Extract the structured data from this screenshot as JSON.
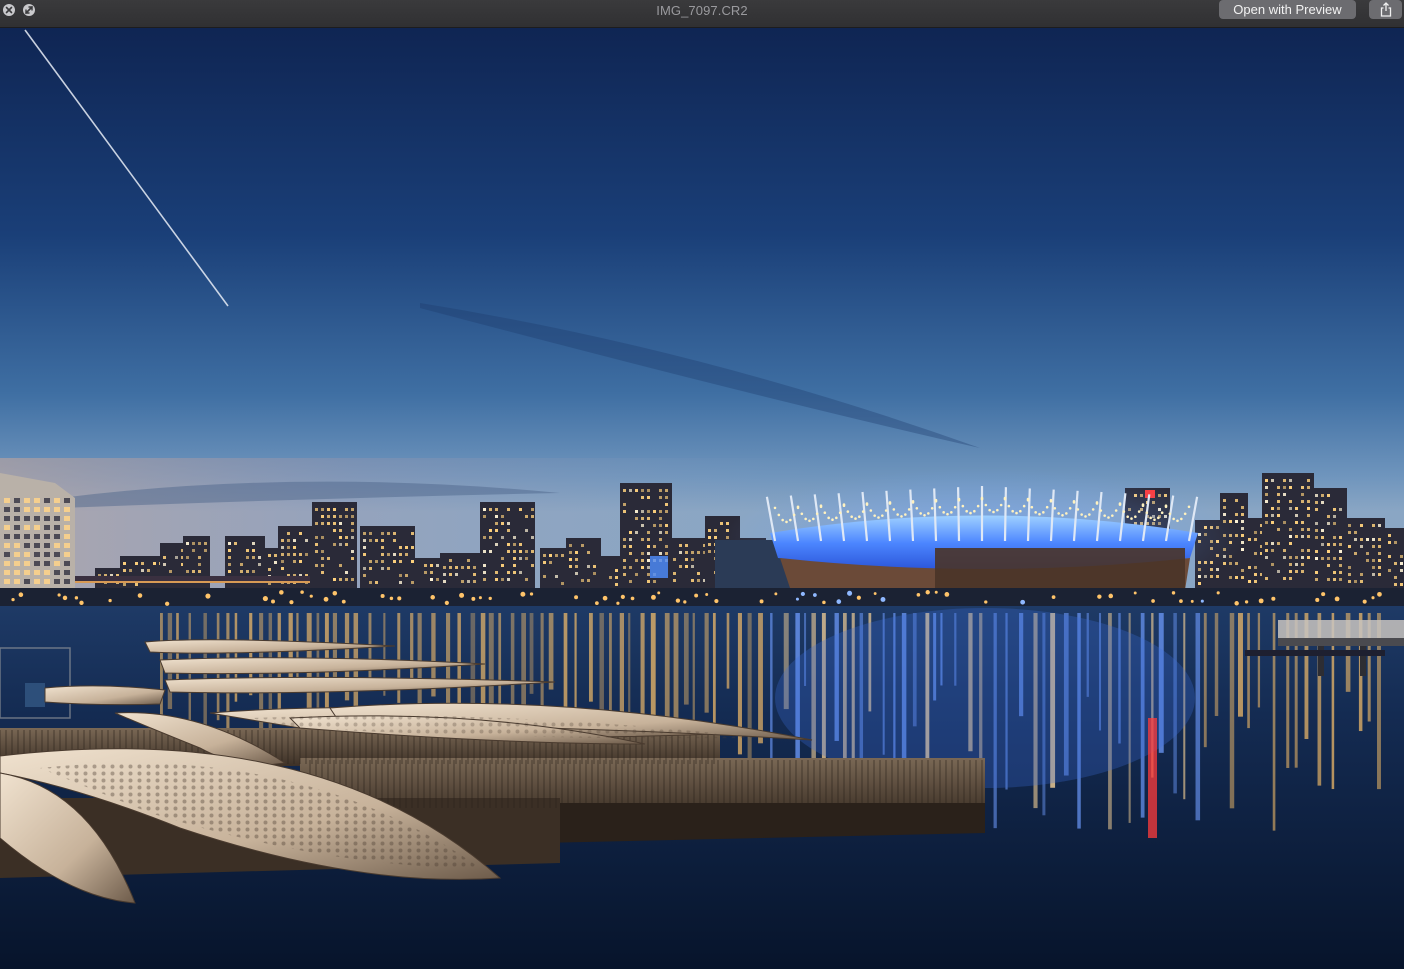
{
  "window": {
    "title": "IMG_7097.CR2",
    "controls": {
      "close_icon": "close-icon",
      "fullscreen_icon": "fullscreen-icon"
    }
  },
  "toolbar": {
    "open_label": "Open with Preview",
    "share_icon": "share-icon"
  },
  "photo": {
    "description_kind": "night-city-skyline-waterfront",
    "colors": {
      "sky_top": "#112a5c",
      "sky_horizon": "#5f86b0",
      "water": "#0c1d3a",
      "stadium_glow": "#4f8fff",
      "city_lights": "#ffcf7a"
    }
  }
}
